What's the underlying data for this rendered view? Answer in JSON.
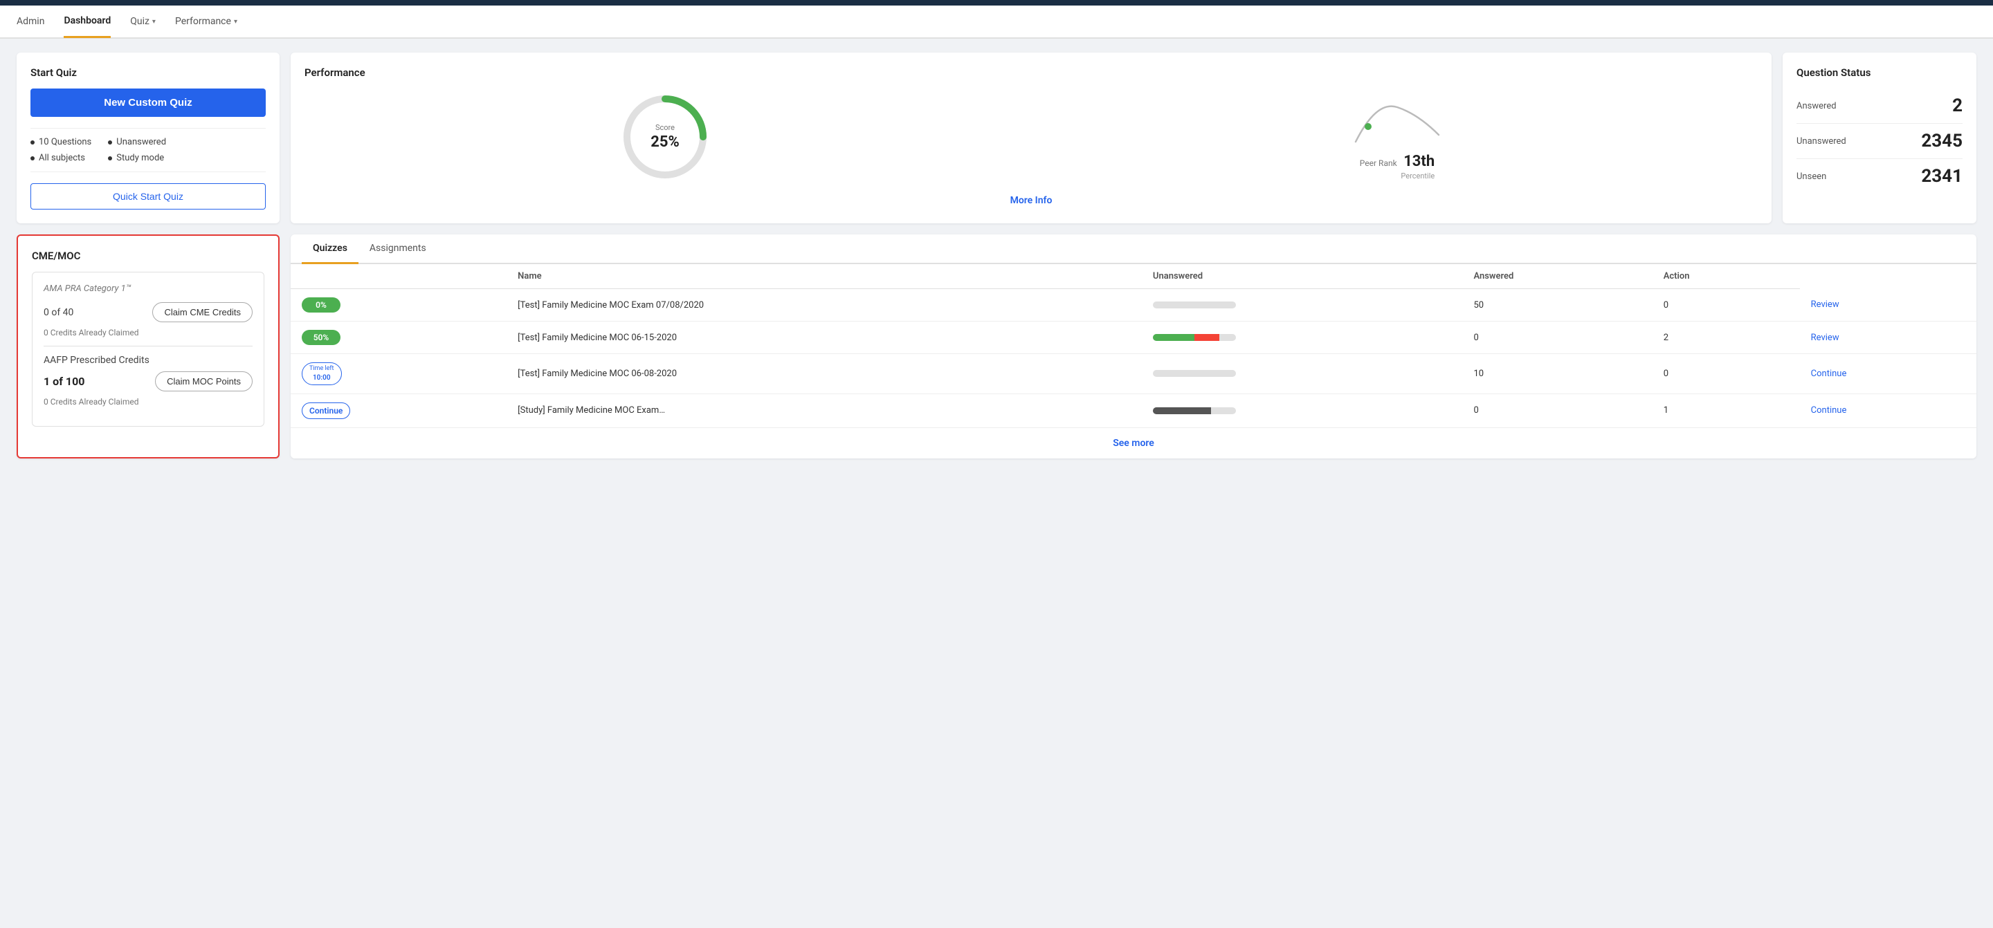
{
  "nav": {
    "items": [
      {
        "label": "Admin",
        "active": false
      },
      {
        "label": "Dashboard",
        "active": true
      },
      {
        "label": "Quiz",
        "hasChevron": true,
        "active": false
      },
      {
        "label": "Performance",
        "hasChevron": true,
        "active": false
      }
    ]
  },
  "startQuiz": {
    "title": "Start Quiz",
    "newCustomQuizLabel": "New Custom Quiz",
    "options": {
      "col1": [
        "10 Questions",
        "All subjects"
      ],
      "col2": [
        "Unanswered",
        "Study mode"
      ]
    },
    "quickStartLabel": "Quick Start Quiz"
  },
  "performance": {
    "title": "Performance",
    "scoreLabel": "Score",
    "scoreValue": "25%",
    "peerRankLabel": "Peer Rank",
    "peerRankValue": "13th",
    "peerRankSub": "Percentile",
    "moreInfoLabel": "More Info"
  },
  "questionStatus": {
    "title": "Question Status",
    "rows": [
      {
        "label": "Answered",
        "value": "2"
      },
      {
        "label": "Unanswered",
        "value": "2345"
      },
      {
        "label": "Unseen",
        "value": "2341"
      }
    ]
  },
  "cme": {
    "title": "CME/MOC",
    "category1": {
      "label": "AMA PRA Category 1™",
      "count": "0 of 40",
      "claimLabel": "Claim CME Credits",
      "creditsLabel": "0 Credits Already Claimed"
    },
    "category2": {
      "label": "AAFP Prescribed Credits",
      "count": "1 of 100",
      "claimLabel": "Claim MOC Points",
      "creditsLabel": "0 Credits Already Claimed"
    }
  },
  "quizzes": {
    "tabs": [
      "Quizzes",
      "Assignments"
    ],
    "activeTab": "Quizzes",
    "columns": [
      "Name",
      "Unanswered",
      "Answered",
      "Action"
    ],
    "rows": [
      {
        "badge": "0%",
        "badgeType": "green",
        "name": "[Test] Family Medicine MOC Exam 07/08/2020",
        "unanswered": "50",
        "answered": "0",
        "actionLabel": "Review",
        "progress": {
          "green": 0,
          "red": 0,
          "dark": 0,
          "empty": 100
        }
      },
      {
        "badge": "50%",
        "badgeType": "green",
        "name": "[Test] Family Medicine MOC 06-15-2020",
        "unanswered": "0",
        "answered": "2",
        "actionLabel": "Review",
        "progress": {
          "green": 50,
          "red": 30,
          "dark": 0,
          "empty": 20
        }
      },
      {
        "badge": "10:00",
        "badgeType": "timeleft",
        "name": "[Test] Family Medicine MOC 06-08-2020",
        "unanswered": "10",
        "answered": "0",
        "actionLabel": "Continue",
        "progress": {
          "green": 0,
          "red": 0,
          "dark": 0,
          "empty": 100
        }
      },
      {
        "badge": "Continue",
        "badgeType": "continue",
        "name": "[Study] Family Medicine MOC Exam…",
        "unanswered": "0",
        "answered": "1",
        "actionLabel": "Continue",
        "progress": {
          "green": 0,
          "red": 0,
          "dark": 70,
          "empty": 30
        }
      }
    ],
    "seeMoreLabel": "See more"
  }
}
